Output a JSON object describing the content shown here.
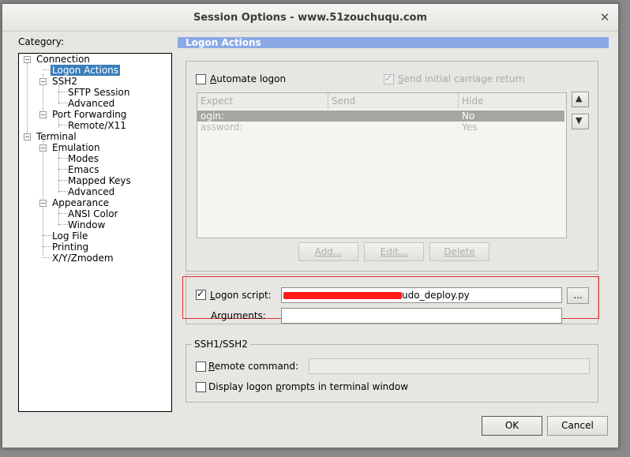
{
  "window": {
    "title": "Session Options - www.51zouchuqu.com",
    "close_glyph": "✕"
  },
  "category": {
    "label": "Category:",
    "tree": [
      {
        "id": "connection",
        "label": "Connection"
      },
      {
        "id": "logon-actions",
        "label": "Logon Actions",
        "selected": true
      },
      {
        "id": "ssh2",
        "label": "SSH2"
      },
      {
        "id": "sftp-session",
        "label": "SFTP Session"
      },
      {
        "id": "advanced-1",
        "label": "Advanced"
      },
      {
        "id": "port-forwarding",
        "label": "Port Forwarding"
      },
      {
        "id": "remote-x11",
        "label": "Remote/X11"
      },
      {
        "id": "terminal",
        "label": "Terminal"
      },
      {
        "id": "emulation",
        "label": "Emulation"
      },
      {
        "id": "modes",
        "label": "Modes"
      },
      {
        "id": "emacs",
        "label": "Emacs"
      },
      {
        "id": "mapped-keys",
        "label": "Mapped Keys"
      },
      {
        "id": "advanced-2",
        "label": "Advanced"
      },
      {
        "id": "appearance",
        "label": "Appearance"
      },
      {
        "id": "ansi-color",
        "label": "ANSI Color"
      },
      {
        "id": "window",
        "label": "Window"
      },
      {
        "id": "log-file",
        "label": "Log File"
      },
      {
        "id": "printing",
        "label": "Printing"
      },
      {
        "id": "xyzmodem",
        "label": "X/Y/Zmodem"
      }
    ],
    "expander_glyph": "−"
  },
  "panel": {
    "header": "Logon Actions",
    "automate_logon": {
      "label_prefix": "A",
      "label_rest": "utomate logon",
      "checked": false
    },
    "send_cr": {
      "label_prefix": "S",
      "label_rest": "end initial carriage return",
      "checked": true
    },
    "table": {
      "columns": [
        "Expect",
        "Send",
        "Hide"
      ],
      "rows": [
        {
          "expect": "ogin:",
          "send": "",
          "hide": "No"
        },
        {
          "expect": "assword:",
          "send": "",
          "hide": "Yes"
        }
      ]
    },
    "buttons": {
      "add": "Add...",
      "edit": "Edit...",
      "delete": "Delete",
      "up": "▲",
      "down": "▼"
    },
    "logon_script": {
      "label_prefix": "L",
      "label_rest": "ogon script:",
      "checked": true,
      "value_suffix": "udo_deploy.py",
      "browse": "..."
    },
    "arguments": {
      "label": "Arguments:",
      "value": ""
    },
    "ssh1": {
      "group_label": "SSH1/SSH2",
      "remote_command": {
        "label_prefix": "R",
        "label_rest": "emote command:",
        "checked": false,
        "value": ""
      },
      "display_prompts": {
        "label_before": "Display logon ",
        "label_prefix": "p",
        "label_rest": "rompts in terminal window",
        "checked": false
      }
    }
  },
  "footer": {
    "ok": "OK",
    "cancel": "Cancel"
  },
  "colors": {
    "accent": "#8aa9e6",
    "selection": "#3a7fbd",
    "highlight": "#e03030",
    "redaction": "#ff1a1a"
  }
}
